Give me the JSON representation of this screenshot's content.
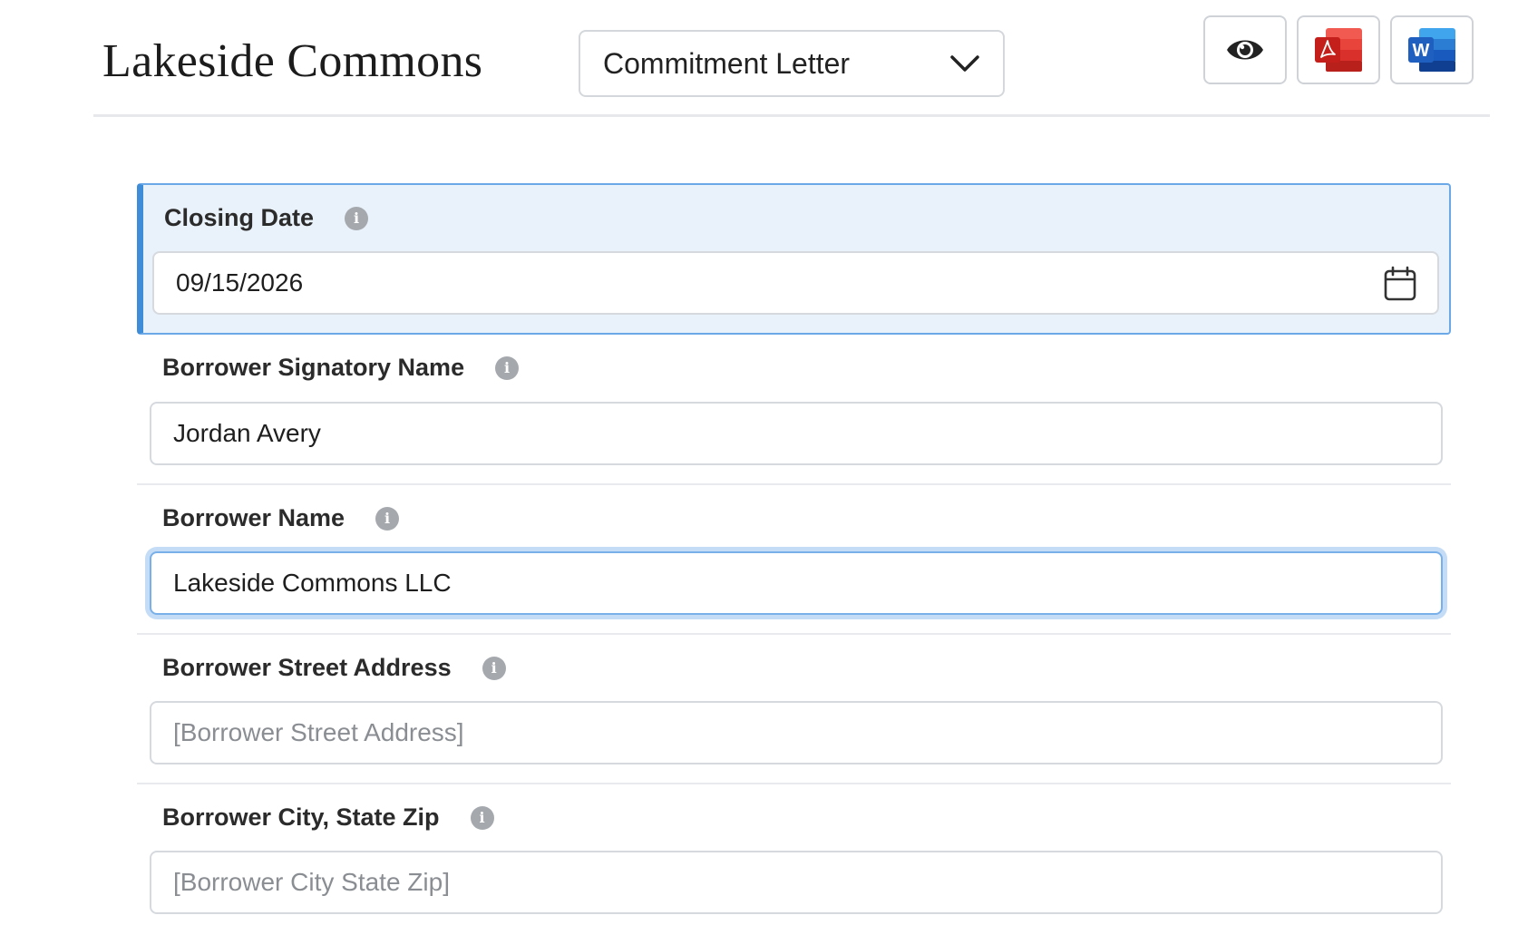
{
  "header": {
    "title": "Lakeside Commons",
    "document_select": {
      "value": "Commitment Letter"
    },
    "buttons": [
      {
        "name": "preview",
        "icon": "eye-icon"
      },
      {
        "name": "pdf",
        "icon": "pdf-icon"
      },
      {
        "name": "word",
        "icon": "word-icon",
        "letter": "W"
      }
    ]
  },
  "fields": {
    "closing_date": {
      "label": "Closing Date",
      "value": "09/15/2026",
      "info": "i"
    },
    "signatory_name": {
      "label": "Borrower Signatory Name",
      "value": "Jordan Avery",
      "info": "i"
    },
    "borrower_name": {
      "label": "Borrower Name",
      "value": "Lakeside Commons LLC",
      "info": "i"
    },
    "street_address": {
      "label": "Borrower Street Address",
      "placeholder": "[Borrower Street Address]",
      "info": "i"
    },
    "city_state_zip": {
      "label": "Borrower City, State Zip",
      "placeholder": "[Borrower City State Zip]",
      "info": "i"
    }
  },
  "colors": {
    "active_bg": "#e9f1fa",
    "active_border": "#3f8dd8",
    "focus_ring": "#c4dcf6",
    "pdf_red": "#d9302c",
    "word_blue": "#1f5fbf"
  }
}
